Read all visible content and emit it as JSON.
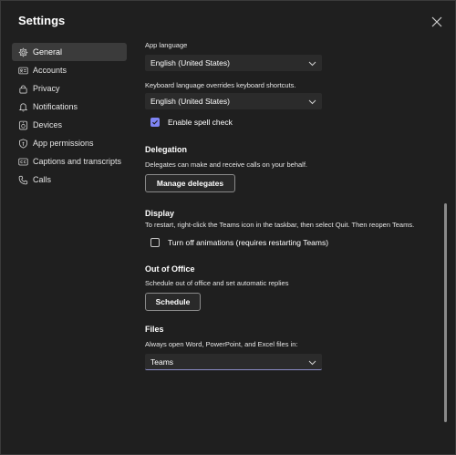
{
  "window": {
    "title": "Settings"
  },
  "sidebar": {
    "items": [
      {
        "label": "General",
        "icon": "gear-icon",
        "active": true
      },
      {
        "label": "Accounts",
        "icon": "accounts-card-icon",
        "active": false
      },
      {
        "label": "Privacy",
        "icon": "lock-icon",
        "active": false
      },
      {
        "label": "Notifications",
        "icon": "bell-icon",
        "active": false
      },
      {
        "label": "Devices",
        "icon": "devices-icon",
        "active": false
      },
      {
        "label": "App permissions",
        "icon": "shield-icon",
        "active": false
      },
      {
        "label": "Captions and transcripts",
        "icon": "captions-icon",
        "active": false
      },
      {
        "label": "Calls",
        "icon": "phone-icon",
        "active": false
      }
    ]
  },
  "general": {
    "app_language_label": "App language",
    "app_language_value": "English (United States)",
    "keyboard_language_label": "Keyboard language overrides keyboard shortcuts.",
    "keyboard_language_value": "English (United States)",
    "spell_check_label": "Enable spell check",
    "spell_check_checked": true
  },
  "delegation": {
    "title": "Delegation",
    "description": "Delegates can make and receive calls on your behalf.",
    "button_label": "Manage delegates"
  },
  "display": {
    "title": "Display",
    "description": "To restart, right-click the Teams icon in the taskbar, then select Quit. Then reopen Teams.",
    "animations_label": "Turn off animations (requires restarting Teams)",
    "animations_checked": false
  },
  "out_of_office": {
    "title": "Out of Office",
    "description": "Schedule out of office and set automatic replies",
    "button_label": "Schedule"
  },
  "files": {
    "title": "Files",
    "description": "Always open Word, PowerPoint, and Excel files in:",
    "value": "Teams"
  },
  "colors": {
    "background": "#1f1f1f",
    "accent": "#7f85f5",
    "active_nav": "#3b3b3b"
  }
}
